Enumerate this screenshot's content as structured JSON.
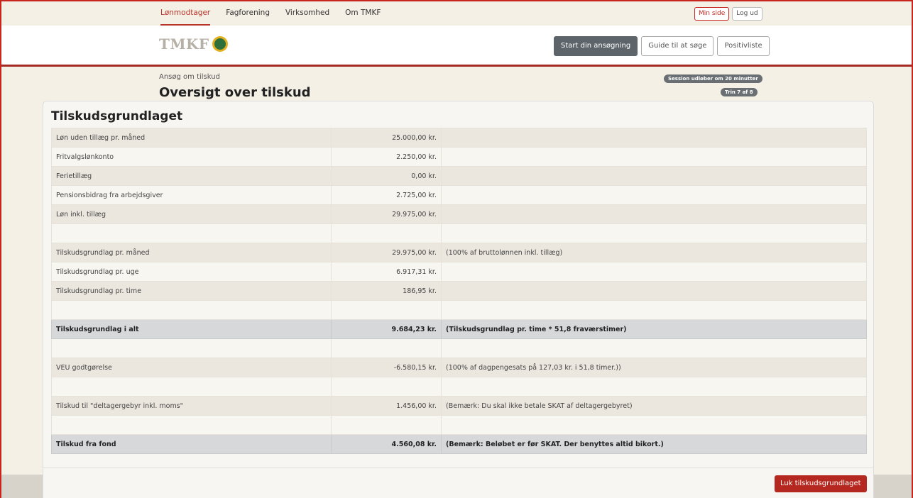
{
  "nav": {
    "links": [
      "Lønmodtager",
      "Fagforening",
      "Virksomhed",
      "Om TMKF"
    ],
    "my_page": "Min side",
    "logout": "Log ud"
  },
  "header": {
    "logo_text": "TMKF",
    "buttons": [
      "Start din ansøgning",
      "Guide til at søge",
      "Positivliste"
    ]
  },
  "page": {
    "breadcrumb": "Ansøg om tilskud",
    "title": "Oversigt over tilskud",
    "session_badge": "Session udløber om 20 minutter",
    "step_badge": "Trin 7 af 8"
  },
  "modal": {
    "title": "Tilskudsgrundlaget",
    "rows": [
      {
        "label": "Løn uden tillæg pr. måned",
        "value": "25.000,00 kr.",
        "note": "",
        "bold": false
      },
      {
        "label": "Fritvalgslønkonto",
        "value": "2.250,00 kr.",
        "note": "",
        "bold": false
      },
      {
        "label": "Ferietillæg",
        "value": "0,00 kr.",
        "note": "",
        "bold": false
      },
      {
        "label": "Pensionsbidrag fra arbejdsgiver",
        "value": "2.725,00 kr.",
        "note": "",
        "bold": false
      },
      {
        "label": "Løn inkl. tillæg",
        "value": "29.975,00 kr.",
        "note": "",
        "bold": false
      },
      {
        "label": "",
        "value": "",
        "note": "",
        "bold": false,
        "spacer": true
      },
      {
        "label": "Tilskudsgrundlag pr. måned",
        "value": "29.975,00 kr.",
        "note": "(100% af bruttolønnen inkl. tillæg)",
        "bold": false
      },
      {
        "label": "Tilskudsgrundlag pr. uge",
        "value": "6.917,31 kr.",
        "note": "",
        "bold": false
      },
      {
        "label": "Tilskudsgrundlag pr. time",
        "value": "186,95 kr.",
        "note": "",
        "bold": false
      },
      {
        "label": "",
        "value": "",
        "note": "",
        "bold": false,
        "spacer": true
      },
      {
        "label": "Tilskudsgrundlag i alt",
        "value": "9.684,23 kr.",
        "note": "(Tilskudsgrundlag pr. time * 51,8 fraværstimer)",
        "bold": true
      },
      {
        "label": "",
        "value": "",
        "note": "",
        "bold": false,
        "spacer": true
      },
      {
        "label": "VEU godtgørelse",
        "value": "-6.580,15 kr.",
        "note": "(100% af dagpengesats på 127,03 kr. i 51,8 timer.))",
        "bold": false
      },
      {
        "label": "",
        "value": "",
        "note": "",
        "bold": false,
        "spacer": true
      },
      {
        "label": "Tilskud til \"deltagergebyr inkl. moms\"",
        "value": "1.456,00 kr.",
        "note": "(Bemærk: Du skal ikke betale SKAT af deltagergebyret)",
        "bold": false
      },
      {
        "label": "",
        "value": "",
        "note": "",
        "bold": false,
        "spacer": true
      },
      {
        "label": "Tilskud fra fond",
        "value": "4.560,08 kr.",
        "note": "(Bemærk: Beløbet er før SKAT. Der benyttes altid bikort.)",
        "bold": true
      }
    ],
    "close_button": "Luk tilskudsgrundlaget"
  }
}
